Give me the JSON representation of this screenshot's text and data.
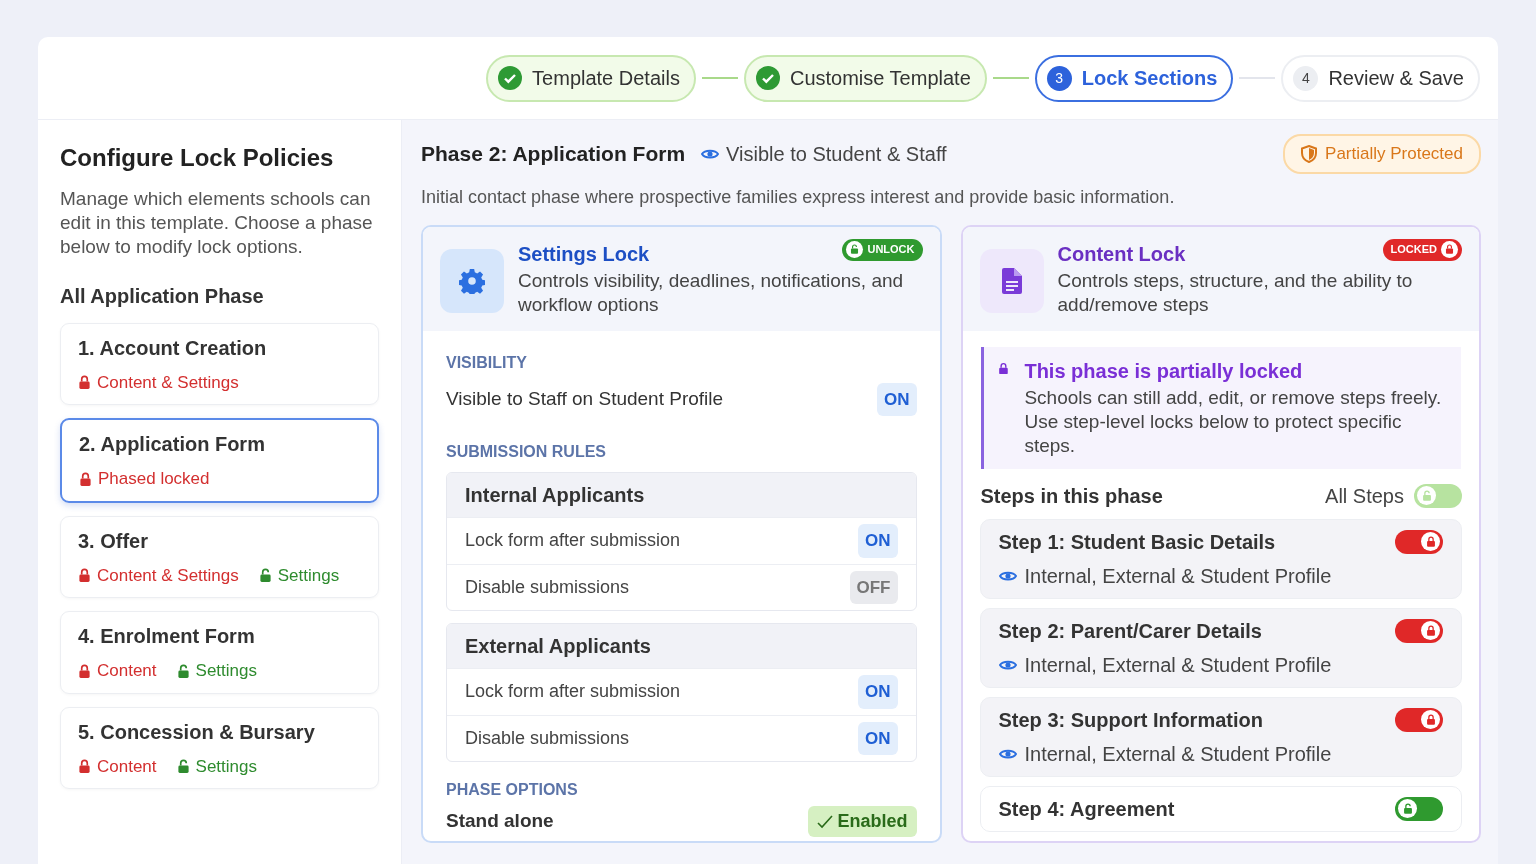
{
  "stepper": [
    {
      "label": "Template Details",
      "completed": true,
      "selected": false
    },
    {
      "label": "Customise Template",
      "completed": true,
      "selected": false
    },
    {
      "number": "3",
      "label": "Lock Sections",
      "completed": false,
      "selected": true
    },
    {
      "number": "4",
      "label": "Review & Save",
      "completed": false,
      "selected": false
    }
  ],
  "sidebar": {
    "title": "Configure Lock Policies",
    "description": "Manage which elements schools can edit in this template. Choose a phase below to modify lock options.",
    "section_title": "All Application Phase",
    "phases": [
      {
        "title": "1. Account Creation",
        "selected": false,
        "tags": [
          {
            "label": "Content & Settings",
            "locked": true
          }
        ]
      },
      {
        "title": "2. Application Form",
        "selected": true,
        "tags": [
          {
            "label": "Phased locked",
            "locked": true
          }
        ]
      },
      {
        "title": "3. Offer",
        "selected": false,
        "tags": [
          {
            "label": "Content & Settings",
            "locked": true
          },
          {
            "label": "Settings",
            "locked": false
          }
        ]
      },
      {
        "title": "4. Enrolment Form",
        "selected": false,
        "tags": [
          {
            "label": "Content",
            "locked": true
          },
          {
            "label": "Settings",
            "locked": false
          }
        ]
      },
      {
        "title": "5. Concession & Bursary",
        "selected": false,
        "tags": [
          {
            "label": "Content",
            "locked": true
          },
          {
            "label": "Settings",
            "locked": false
          }
        ]
      }
    ]
  },
  "phase": {
    "title": "Phase 2: Application Form",
    "visibility": "Visible to Student & Staff",
    "protection": "Partially Protected",
    "description": "Initial contact phase where prospective families express interest and provide basic information."
  },
  "settings_lock": {
    "title": "Settings Lock",
    "description": "Controls visibility, deadlines, notifications, and workflow options",
    "badge": "UNLOCK",
    "locked": false,
    "visibility": {
      "heading": "VISIBILITY",
      "rows": [
        {
          "label": "Visible to Staff on Student Profile",
          "value": "ON",
          "on": true
        }
      ]
    },
    "submission_rules": {
      "heading": "SUBMISSION RULES",
      "groups": [
        {
          "title": "Internal Applicants",
          "rows": [
            {
              "label": "Lock form after submission",
              "value": "ON",
              "on": true
            },
            {
              "label": "Disable submissions",
              "value": "OFF",
              "on": false
            }
          ]
        },
        {
          "title": "External Applicants",
          "rows": [
            {
              "label": "Lock form after submission",
              "value": "ON",
              "on": true
            },
            {
              "label": "Disable submissions",
              "value": "ON",
              "on": true
            }
          ]
        }
      ]
    },
    "phase_options": {
      "heading": "PHASE OPTIONS",
      "rows": [
        {
          "label": "Stand alone",
          "value": "Enabled",
          "on": true
        }
      ]
    }
  },
  "content_lock": {
    "title": "Content Lock",
    "description": "Controls steps, structure, and the ability to add/remove steps",
    "badge": "LOCKED",
    "locked": true,
    "notice": {
      "title": "This phase is partially locked",
      "text": "Schools can still add, edit, or remove steps freely. Use step-level locks below to protect specific steps."
    },
    "steps_heading": "Steps in this phase",
    "all_steps": {
      "label": "All Steps",
      "locked": false
    },
    "steps": [
      {
        "title": "Step 1: Student Basic Details",
        "audience": "Internal, External & Student Profile",
        "locked": true
      },
      {
        "title": "Step 2: Parent/Carer Details",
        "audience": "Internal, External & Student Profile",
        "locked": true
      },
      {
        "title": "Step 3: Support Information",
        "audience": "Internal, External & Student Profile",
        "locked": true
      },
      {
        "title": "Step 4: Agreement",
        "locked": false
      }
    ]
  }
}
